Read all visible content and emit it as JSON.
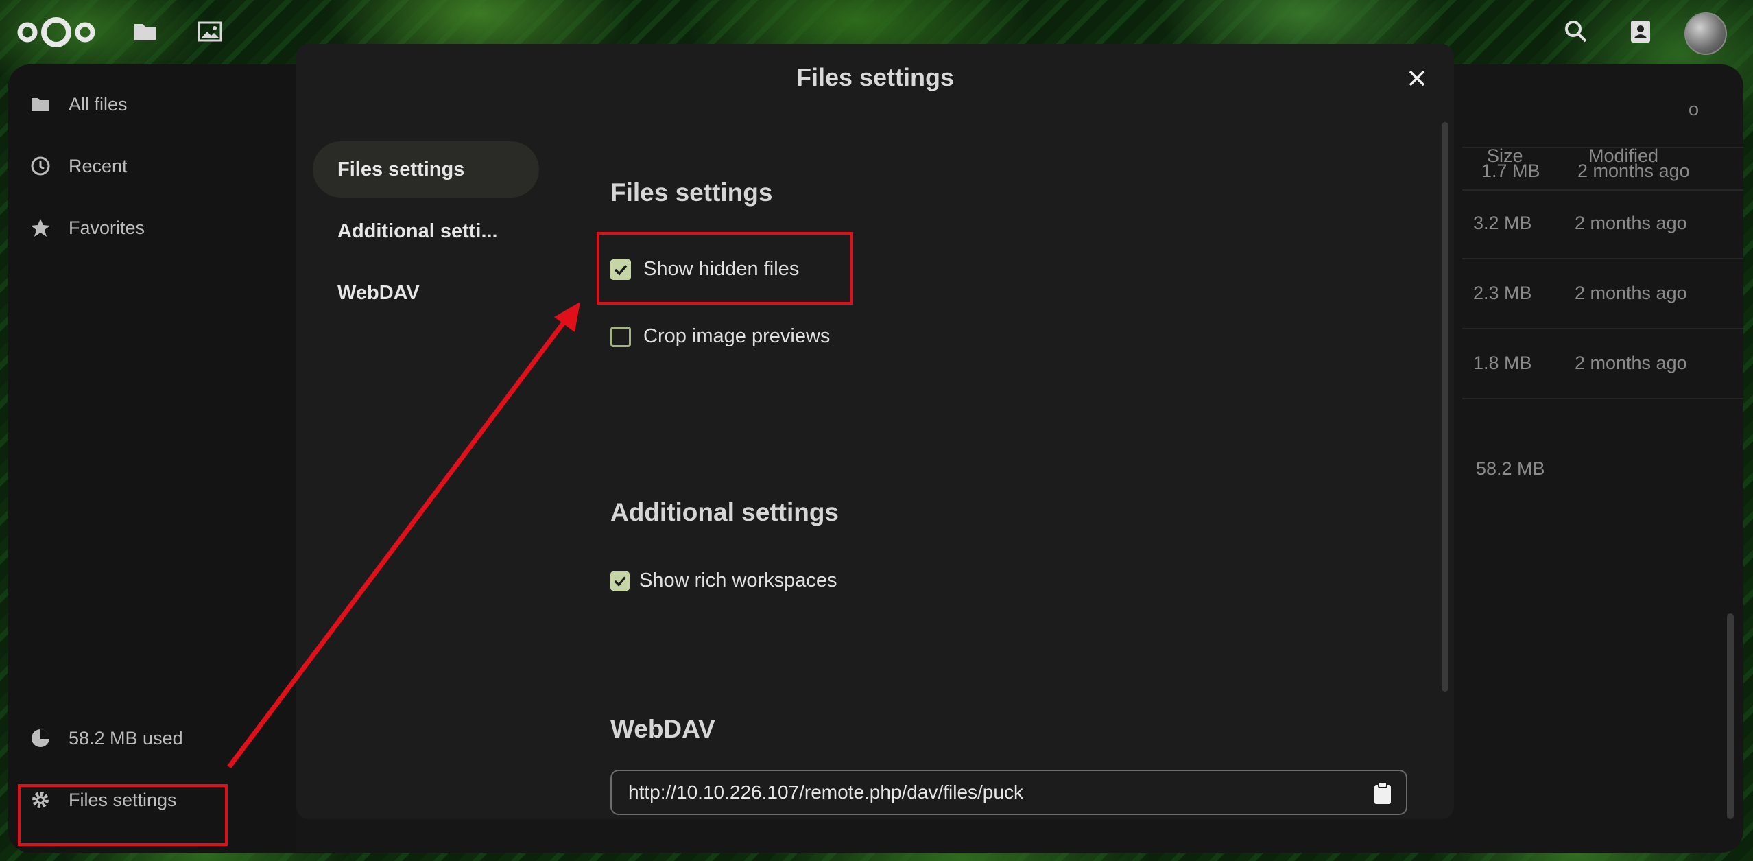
{
  "header": {
    "logo_icon": "nextcloud-logo-icon",
    "apps": [
      "files-app-icon",
      "photos-app-icon"
    ],
    "right_icons": [
      "search-icon",
      "contacts-icon",
      "avatar"
    ]
  },
  "sidebar": {
    "items": [
      {
        "label": "All files",
        "icon": "folder-icon"
      },
      {
        "label": "Recent",
        "icon": "clock-icon"
      },
      {
        "label": "Favorites",
        "icon": "star-icon"
      }
    ],
    "quota_label": "58.2 MB used",
    "settings_label": "Files settings"
  },
  "filelist": {
    "partial_top": "o",
    "col_size": "Size",
    "col_modified": "Modified",
    "rows": [
      {
        "size": "1.7 MB",
        "modified": "2 months ago"
      },
      {
        "size": "3.2 MB",
        "modified": "2 months ago"
      },
      {
        "size": "2.3 MB",
        "modified": "2 months ago"
      },
      {
        "size": "1.8 MB",
        "modified": "2 months ago"
      }
    ],
    "total_size": "58.2 MB"
  },
  "modal": {
    "title": "Files settings",
    "nav": [
      "Files settings",
      "Additional setti...",
      "WebDAV"
    ],
    "files_settings": {
      "title": "Files settings",
      "show_hidden": {
        "label": "Show hidden files",
        "checked": true
      },
      "crop_previews": {
        "label": "Crop image previews",
        "checked": false
      }
    },
    "additional": {
      "title": "Additional settings",
      "rich_workspaces": {
        "label": "Show rich workspaces",
        "checked": true
      }
    },
    "webdav": {
      "title": "WebDAV",
      "url": "http://10.10.226.107/remote.php/dav/files/puck"
    }
  },
  "annotation_color": "#e0101a"
}
